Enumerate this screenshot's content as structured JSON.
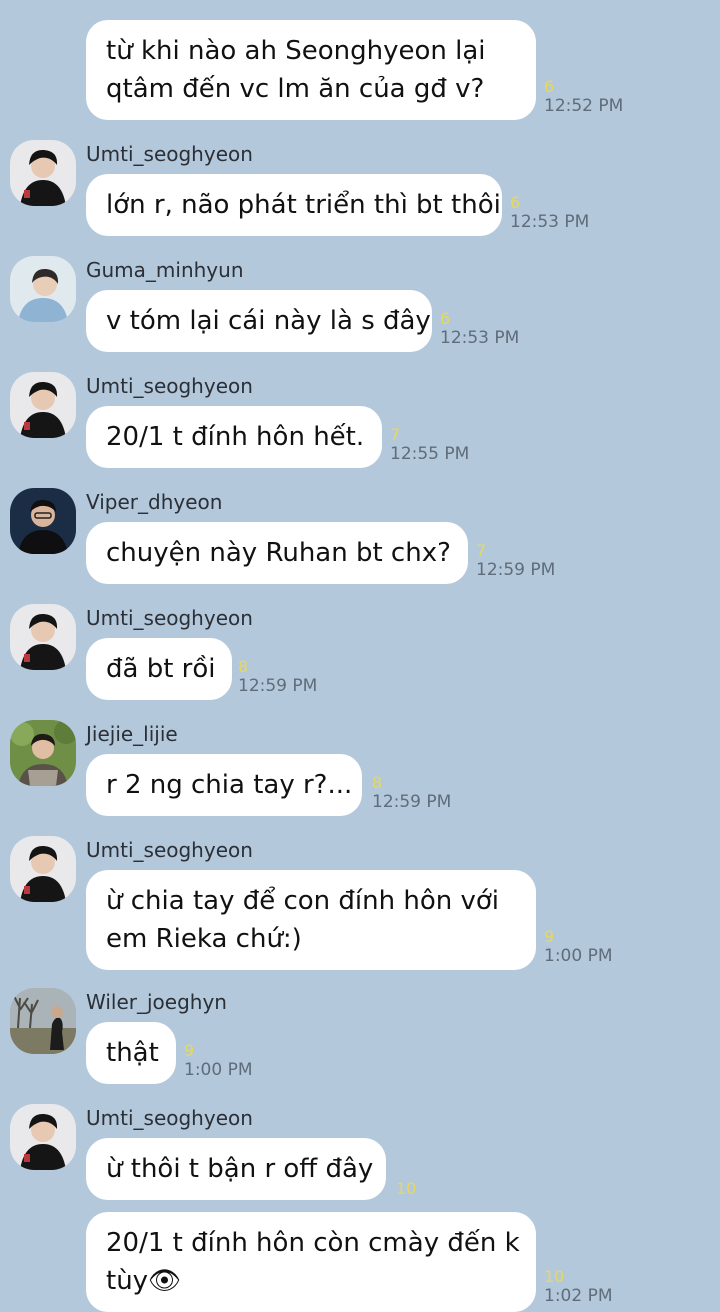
{
  "messages": [
    {
      "sender": "",
      "avatar": "",
      "lines": [
        "từ khi nào ah Seonghyeon lại",
        "qtâm đến vc lm ăn của gđ v?"
      ],
      "read": "6",
      "time": "12:52 PM"
    },
    {
      "sender": "Umti_seoghyeon",
      "avatar": "avatar-umti",
      "lines": [
        "lớn r, não phát triển thì bt thôi"
      ],
      "read": "6",
      "time": "12:53 PM"
    },
    {
      "sender": "Guma_minhyun",
      "avatar": "avatar-guma",
      "lines": [
        "v tóm lại cái này là s đây"
      ],
      "read": "6",
      "time": "12:53 PM"
    },
    {
      "sender": "Umti_seoghyeon",
      "avatar": "avatar-umti",
      "lines": [
        "20/1 t đính hôn hết."
      ],
      "read": "7",
      "time": "12:55 PM"
    },
    {
      "sender": "Viper_dhyeon",
      "avatar": "avatar-viper",
      "lines": [
        "chuyện này Ruhan bt chx?"
      ],
      "read": "7",
      "time": "12:59 PM"
    },
    {
      "sender": "Umti_seoghyeon",
      "avatar": "avatar-umti",
      "lines": [
        "đã bt rồi"
      ],
      "read": "8",
      "time": "12:59 PM"
    },
    {
      "sender": "Jiejie_lijie",
      "avatar": "avatar-jiejie",
      "lines": [
        "r 2 ng chia tay r?..."
      ],
      "read": "8",
      "time": "12:59 PM"
    },
    {
      "sender": "Umti_seoghyeon",
      "avatar": "avatar-umti",
      "lines": [
        "ừ chia tay để con đính hôn với",
        "em Rieka chứ:)"
      ],
      "read": "9",
      "time": "1:00 PM"
    },
    {
      "sender": "Wiler_joeghyn",
      "avatar": "avatar-wiler",
      "lines": [
        "thật"
      ],
      "read": "9",
      "time": "1:00 PM"
    },
    {
      "sender": "Umti_seoghyeon",
      "avatar": "avatar-umti",
      "lines": [
        "ừ thôi t bận r off đây"
      ],
      "read": "10",
      "time": ""
    },
    {
      "sender": "",
      "avatar": "",
      "lines": [
        "20/1 t đính hôn còn cmày đến k",
        "tùy👁"
      ],
      "read": "10",
      "time": "1:02 PM"
    }
  ]
}
